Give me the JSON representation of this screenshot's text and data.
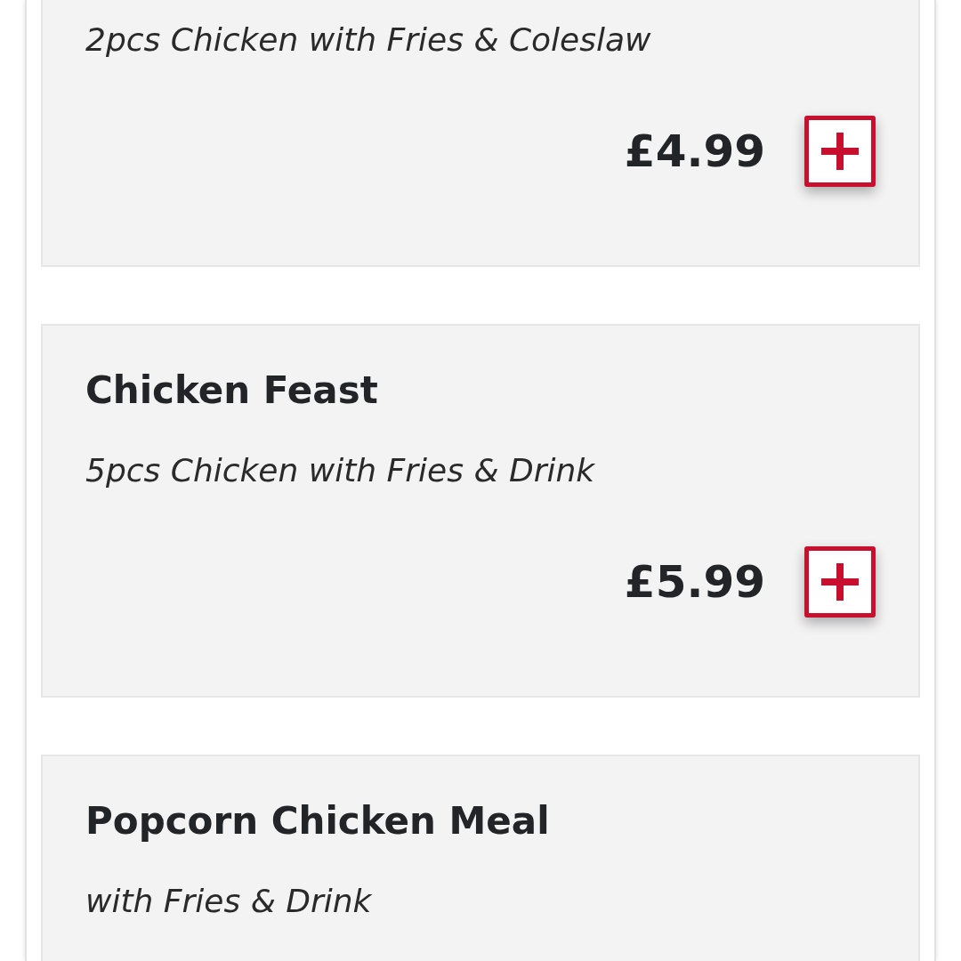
{
  "items": [
    {
      "description": "2pcs Chicken with Fries & Coleslaw",
      "price": "£4.99"
    },
    {
      "title": "Chicken Feast",
      "description": "5pcs Chicken with Fries & Drink",
      "price": "£5.99"
    },
    {
      "title": "Popcorn Chicken Meal",
      "description": "with Fries & Drink"
    }
  ]
}
